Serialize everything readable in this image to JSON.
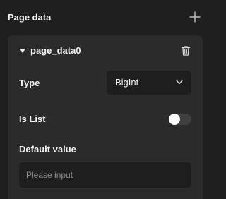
{
  "panel": {
    "title": "Page data",
    "add_icon": "plus-icon"
  },
  "item": {
    "name": "page_data0",
    "expanded": true,
    "collapse_icon": "caret-down-icon",
    "delete_icon": "trash-icon",
    "type_label": "Type",
    "type_value": "BigInt",
    "type_dropdown_icon": "chevron-down-icon",
    "is_list_label": "Is List",
    "is_list_value": false,
    "default_label": "Default value",
    "default_value": "",
    "default_placeholder": "Please input"
  },
  "colors": {
    "background": "#1f1f1f",
    "card": "#2b2b2b",
    "field": "#1e1e1e",
    "text": "#f2f2f2",
    "placeholder": "#8c8c8c",
    "toggle_track": "#3f3f3f"
  }
}
